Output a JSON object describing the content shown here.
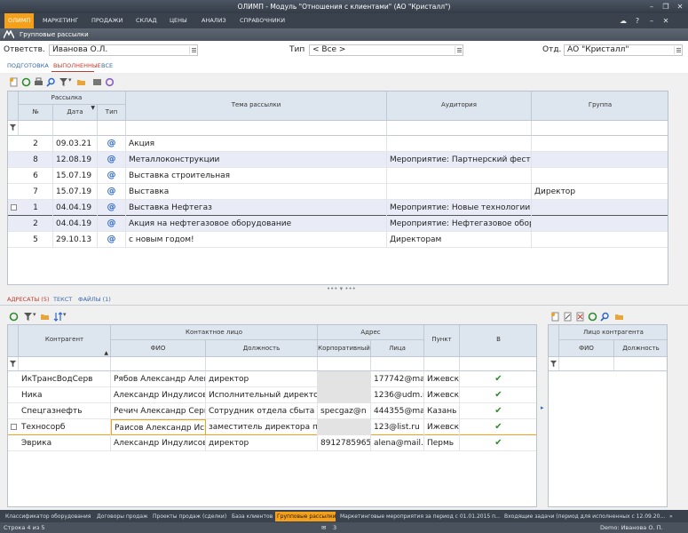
{
  "window": {
    "title": "ОЛИМП - Модуль \"Отношения с клиентами\" (АО \"Кристалл\")",
    "controls": [
      "–",
      "❐",
      "✕"
    ]
  },
  "menu": {
    "items": [
      "ОЛИМП",
      "МАРКЕТИНГ",
      "ПРОДАЖИ",
      "СКЛАД",
      "ЦЕНЫ",
      "АНАЛИЗ",
      "СПРАВОЧНИКИ"
    ],
    "right": [
      "☁",
      "?",
      "–",
      "✕"
    ]
  },
  "section": {
    "title": "Групповые рассылки"
  },
  "filters": {
    "responsible_label": "Ответств.",
    "responsible_value": "Иванова О.Л.",
    "type_label": "Тип",
    "type_value": "< Все >",
    "dept_label": "Отд.",
    "dept_value": "АО \"Кристалл\""
  },
  "tabs": [
    "ПОДГОТОВКА",
    "ВЫПОЛНЕННЫЕ",
    "ВСЕ"
  ],
  "top_grid": {
    "group_header": "Рассылка",
    "columns": [
      "№",
      "Дата",
      "Тип",
      "Тема рассылки",
      "Аудитория",
      "Группа"
    ],
    "rows": [
      {
        "num": "2",
        "date": "09.03.21",
        "type": "@",
        "topic": "Акция",
        "audience": "",
        "group": ""
      },
      {
        "num": "8",
        "date": "12.08.19",
        "type": "@",
        "topic": "Металлоконструкции",
        "audience": "Мероприятие: Партнерский фест",
        "group": ""
      },
      {
        "num": "6",
        "date": "15.07.19",
        "type": "@",
        "topic": "Выставка строительная",
        "audience": "",
        "group": ""
      },
      {
        "num": "7",
        "date": "15.07.19",
        "type": "@",
        "topic": "Выставка",
        "audience": "",
        "group": "Директор"
      },
      {
        "num": "1",
        "date": "04.04.19",
        "type": "@",
        "topic": "Выставка Нефтегаз",
        "audience": "Мероприятие: Новые технологии в",
        "group": ""
      },
      {
        "num": "2",
        "date": "04.04.19",
        "type": "@",
        "topic": "Акция на нефтегазовое оборудование",
        "audience": "Мероприятие: Нефтегазовое обору",
        "group": ""
      },
      {
        "num": "5",
        "date": "29.10.13",
        "type": "@",
        "topic": "с новым годом!",
        "audience": "Директорам",
        "group": ""
      }
    ]
  },
  "bottom_tabs": [
    "АДРЕСАТЫ (5)",
    "ТЕКСТ",
    "ФАЙЛЫ (1)"
  ],
  "recipients_grid": {
    "group_contact": "Контактное лицо",
    "group_address": "Адрес",
    "columns": [
      "Контрагент",
      "ФИО",
      "Должность",
      "Корпоративный",
      "Лица",
      "Пункт",
      "В"
    ],
    "rows": [
      {
        "company": "ИкТрансВодСерв",
        "fio": "Рябов Александр Алек",
        "position": "директор",
        "corp": "",
        "personal": "177742@ma",
        "city": "Ижевск",
        "sent": "✔"
      },
      {
        "company": "Ника",
        "fio": "Александр Индулисови",
        "position": "Исполнительный директор",
        "corp": "",
        "personal": "1236@udm.r",
        "city": "Ижевск",
        "sent": "✔"
      },
      {
        "company": "Спецгазнефть",
        "fio": "Речич Александр Серг",
        "position": "Сотрудник отдела сбыта",
        "corp": "specgaz@n",
        "personal": "444355@ma",
        "city": "Казань",
        "sent": "✔"
      },
      {
        "company": "Техносорб",
        "fio": "Раисов Александр Иск",
        "position": "заместитель директора по",
        "corp": "",
        "personal": "123@list.ru",
        "city": "Ижевск",
        "sent": "✔"
      },
      {
        "company": "Эврика",
        "fio": "Александр Индулисови",
        "position": "директор",
        "corp": "8912785965",
        "personal": "alena@mail.r",
        "city": "Пермь",
        "sent": "✔"
      }
    ]
  },
  "contact_grid": {
    "group_header": "Лицо контрагента",
    "columns": [
      "ФИО",
      "Должность"
    ]
  },
  "taskbar": [
    "Классификатор оборудования",
    "Договоры продаж",
    "Проекты продаж (сделки)",
    "База клиентов",
    "Групповые рассылки",
    "Маркетинговые мероприятия за период с 01.01.2015 п...",
    "Входящие задачи (период для исполненных с 12.09.20..."
  ],
  "status": {
    "row_info": "Строка 4 из 5",
    "mail_count": "3",
    "user": "Demo: Иванова О. П."
  },
  "colors": {
    "accent": "#f5a01a",
    "header_bg": "#dde6ee",
    "alt_row": "#e9ecf7",
    "link": "#3567a8",
    "active_tab": "#c0392b"
  }
}
